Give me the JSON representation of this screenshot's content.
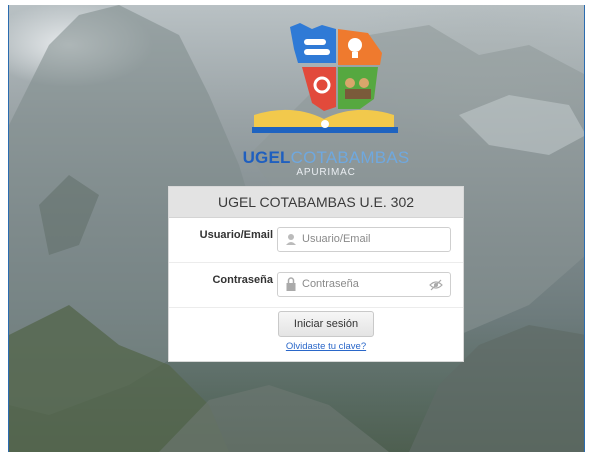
{
  "logo": {
    "brand_bold": "UGEL",
    "brand_light": "COTABAMBAS",
    "region": "APURIMAC"
  },
  "login": {
    "title": "UGEL COTABAMBAS U.E. 302",
    "user_label": "Usuario/Email",
    "user_placeholder": "Usuario/Email",
    "pass_label": "Contraseña",
    "pass_placeholder": "Contraseña",
    "submit_label": "Iniciar sesión",
    "forgot_label": "Olvidaste tu clave?"
  },
  "colors": {
    "brand_blue": "#1f5fbf",
    "light_blue": "#6fa8df",
    "link": "#2a67c9"
  },
  "icons": {
    "user": "user-icon",
    "lock": "lock-icon",
    "eye": "eye-slash-icon"
  }
}
